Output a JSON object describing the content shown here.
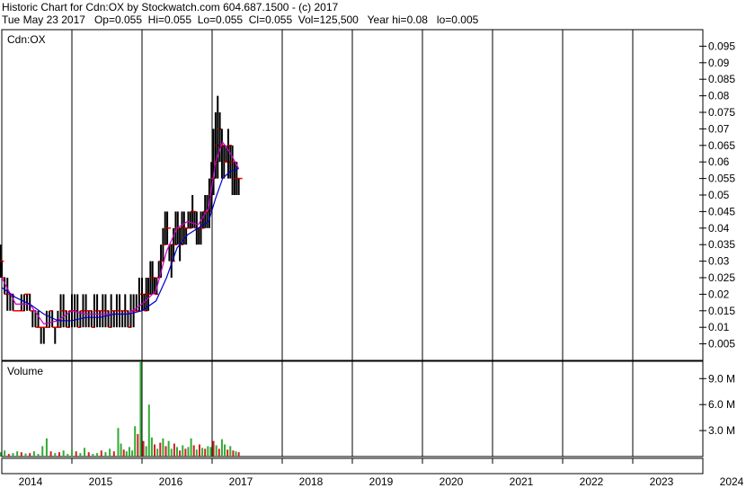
{
  "header": {
    "title_line": "Historic Chart for Cdn:OX by Stockwatch.com 604.687.1500 - (c) 2017",
    "quote_line": "Tue May 23 2017   Op=0.055  Hi=0.055  Lo=0.055  Cl=0.055  Vol=125,500   Year hi=0.08   lo=0.005"
  },
  "colors": {
    "price_bar": "#000000",
    "ma_short": "#cc00cc",
    "ma_long": "#0000cc",
    "close_tick": "#ff0000",
    "vol_up": "#33aa33",
    "vol_down": "#cc2222",
    "grid": "#000000"
  },
  "chart_data": [
    {
      "type": "line",
      "panel": "price",
      "title": "Cdn:OX",
      "y_ticks": [
        "0.095",
        "0.09",
        "0.085",
        "0.08",
        "0.075",
        "0.07",
        "0.065",
        "0.06",
        "0.055",
        "0.05",
        "0.045",
        "0.04",
        "0.035",
        "0.03",
        "0.025",
        "0.02",
        "0.015",
        "0.01",
        "0.005"
      ],
      "ylim": [
        0,
        0.1
      ],
      "x_ticks": [
        "2014",
        "2015",
        "2016",
        "2017",
        "2018",
        "2019",
        "2020",
        "2021",
        "2022",
        "2023",
        "2024"
      ],
      "grid": true,
      "series": [
        {
          "style": "hlc-bars",
          "x": [
            2013.98,
            2014.0,
            2014.04,
            2014.08,
            2014.12,
            2014.16,
            2014.2,
            2014.24,
            2014.28,
            2014.32,
            2014.36,
            2014.4,
            2014.44,
            2014.48,
            2014.52,
            2014.56,
            2014.6,
            2014.64,
            2014.68,
            2014.72,
            2014.76,
            2014.8,
            2014.84,
            2014.88,
            2014.92,
            2014.96,
            2015.0,
            2015.04,
            2015.08,
            2015.12,
            2015.16,
            2015.2,
            2015.24,
            2015.28,
            2015.32,
            2015.36,
            2015.4,
            2015.44,
            2015.48,
            2015.52,
            2015.56,
            2015.6,
            2015.64,
            2015.68,
            2015.72,
            2015.76,
            2015.8,
            2015.84,
            2015.88,
            2015.92,
            2015.96,
            2016.0,
            2016.03,
            2016.06,
            2016.09,
            2016.12,
            2016.15,
            2016.18,
            2016.21,
            2016.24,
            2016.27,
            2016.3,
            2016.33,
            2016.36,
            2016.39,
            2016.42,
            2016.45,
            2016.48,
            2016.51,
            2016.54,
            2016.57,
            2016.6,
            2016.63,
            2016.66,
            2016.69,
            2016.72,
            2016.75,
            2016.78,
            2016.81,
            2016.84,
            2016.87,
            2016.9,
            2016.93,
            2016.96,
            2016.99,
            2017.02,
            2017.05,
            2017.08,
            2017.11,
            2017.14,
            2017.17,
            2017.2,
            2017.23,
            2017.26,
            2017.29,
            2017.32,
            2017.35,
            2017.38
          ],
          "high": [
            0.035,
            0.03,
            0.025,
            0.025,
            0.02,
            0.02,
            0.015,
            0.015,
            0.02,
            0.02,
            0.02,
            0.02,
            0.015,
            0.015,
            0.015,
            0.01,
            0.01,
            0.015,
            0.015,
            0.015,
            0.01,
            0.015,
            0.02,
            0.02,
            0.015,
            0.015,
            0.02,
            0.02,
            0.02,
            0.015,
            0.02,
            0.02,
            0.015,
            0.015,
            0.02,
            0.02,
            0.015,
            0.02,
            0.02,
            0.015,
            0.02,
            0.015,
            0.02,
            0.02,
            0.015,
            0.02,
            0.015,
            0.02,
            0.02,
            0.02,
            0.025,
            0.025,
            0.02,
            0.025,
            0.025,
            0.03,
            0.03,
            0.025,
            0.025,
            0.03,
            0.035,
            0.04,
            0.045,
            0.045,
            0.035,
            0.035,
            0.04,
            0.045,
            0.045,
            0.04,
            0.045,
            0.045,
            0.04,
            0.045,
            0.045,
            0.05,
            0.045,
            0.045,
            0.04,
            0.045,
            0.045,
            0.05,
            0.05,
            0.055,
            0.06,
            0.07,
            0.075,
            0.08,
            0.075,
            0.07,
            0.065,
            0.065,
            0.07,
            0.065,
            0.065,
            0.06,
            0.06,
            0.055
          ],
          "low": [
            0.025,
            0.025,
            0.02,
            0.015,
            0.015,
            0.015,
            0.015,
            0.015,
            0.015,
            0.015,
            0.015,
            0.015,
            0.01,
            0.01,
            0.01,
            0.005,
            0.005,
            0.01,
            0.01,
            0.01,
            0.005,
            0.01,
            0.01,
            0.01,
            0.01,
            0.01,
            0.01,
            0.01,
            0.01,
            0.01,
            0.01,
            0.01,
            0.01,
            0.01,
            0.01,
            0.01,
            0.01,
            0.01,
            0.01,
            0.01,
            0.01,
            0.01,
            0.01,
            0.01,
            0.01,
            0.01,
            0.01,
            0.01,
            0.01,
            0.015,
            0.015,
            0.015,
            0.015,
            0.015,
            0.015,
            0.02,
            0.02,
            0.02,
            0.02,
            0.025,
            0.025,
            0.03,
            0.035,
            0.035,
            0.03,
            0.025,
            0.03,
            0.035,
            0.035,
            0.03,
            0.035,
            0.035,
            0.035,
            0.04,
            0.04,
            0.04,
            0.04,
            0.035,
            0.035,
            0.035,
            0.04,
            0.04,
            0.04,
            0.04,
            0.045,
            0.05,
            0.055,
            0.055,
            0.06,
            0.055,
            0.055,
            0.06,
            0.055,
            0.055,
            0.05,
            0.05,
            0.05,
            0.05
          ],
          "close": [
            0.03,
            0.025,
            0.02,
            0.02,
            0.02,
            0.015,
            0.015,
            0.015,
            0.015,
            0.02,
            0.02,
            0.015,
            0.015,
            0.01,
            0.01,
            0.01,
            0.01,
            0.01,
            0.015,
            0.01,
            0.01,
            0.01,
            0.015,
            0.015,
            0.01,
            0.015,
            0.015,
            0.015,
            0.01,
            0.015,
            0.015,
            0.015,
            0.015,
            0.01,
            0.015,
            0.015,
            0.015,
            0.015,
            0.015,
            0.01,
            0.015,
            0.015,
            0.015,
            0.015,
            0.015,
            0.015,
            0.01,
            0.015,
            0.015,
            0.015,
            0.02,
            0.02,
            0.015,
            0.02,
            0.02,
            0.025,
            0.025,
            0.02,
            0.025,
            0.03,
            0.03,
            0.035,
            0.04,
            0.04,
            0.035,
            0.03,
            0.035,
            0.04,
            0.04,
            0.035,
            0.04,
            0.04,
            0.04,
            0.04,
            0.045,
            0.045,
            0.04,
            0.04,
            0.04,
            0.04,
            0.045,
            0.045,
            0.045,
            0.05,
            0.055,
            0.06,
            0.065,
            0.07,
            0.065,
            0.065,
            0.06,
            0.06,
            0.065,
            0.06,
            0.06,
            0.055,
            0.055,
            0.055
          ]
        },
        {
          "style": "line",
          "color_key": "ma_short",
          "x": [
            2014.0,
            2014.2,
            2014.4,
            2014.6,
            2014.8,
            2015.0,
            2015.2,
            2015.4,
            2015.6,
            2015.8,
            2016.0,
            2016.2,
            2016.35,
            2016.5,
            2016.65,
            2016.8,
            2016.95,
            2017.05,
            2017.15,
            2017.25,
            2017.38
          ],
          "y": [
            0.025,
            0.017,
            0.017,
            0.011,
            0.012,
            0.015,
            0.014,
            0.014,
            0.014,
            0.014,
            0.017,
            0.021,
            0.033,
            0.04,
            0.042,
            0.041,
            0.046,
            0.06,
            0.066,
            0.063,
            0.058
          ]
        },
        {
          "style": "line",
          "color_key": "ma_long",
          "x": [
            2014.0,
            2014.2,
            2014.4,
            2014.6,
            2014.8,
            2015.0,
            2015.2,
            2015.4,
            2015.6,
            2015.8,
            2016.0,
            2016.2,
            2016.35,
            2016.5,
            2016.65,
            2016.8,
            2016.95,
            2017.05,
            2017.15,
            2017.25,
            2017.38
          ],
          "y": [
            0.022,
            0.019,
            0.017,
            0.014,
            0.012,
            0.012,
            0.013,
            0.013,
            0.014,
            0.014,
            0.015,
            0.018,
            0.025,
            0.034,
            0.038,
            0.04,
            0.042,
            0.049,
            0.055,
            0.057,
            0.058
          ]
        }
      ]
    },
    {
      "type": "bar",
      "panel": "volume",
      "title": "Volume",
      "y_ticks": [
        "9.0 M",
        "6.0 M",
        "3.0 M"
      ],
      "ylim": [
        0,
        11000000
      ],
      "x": [
        2013.98,
        2014.04,
        2014.1,
        2014.16,
        2014.22,
        2014.28,
        2014.34,
        2014.4,
        2014.46,
        2014.52,
        2014.58,
        2014.64,
        2014.7,
        2014.76,
        2014.82,
        2014.88,
        2014.94,
        2015.0,
        2015.06,
        2015.12,
        2015.18,
        2015.24,
        2015.3,
        2015.36,
        2015.42,
        2015.48,
        2015.54,
        2015.6,
        2015.66,
        2015.7,
        2015.74,
        2015.78,
        2015.82,
        2015.86,
        2015.9,
        2015.94,
        2015.98,
        2016.02,
        2016.06,
        2016.1,
        2016.14,
        2016.18,
        2016.22,
        2016.26,
        2016.3,
        2016.34,
        2016.38,
        2016.42,
        2016.46,
        2016.5,
        2016.54,
        2016.58,
        2016.62,
        2016.66,
        2016.7,
        2016.74,
        2016.78,
        2016.82,
        2016.86,
        2016.9,
        2016.94,
        2016.98,
        2017.02,
        2017.06,
        2017.1,
        2017.14,
        2017.18,
        2017.22,
        2017.26,
        2017.3,
        2017.34,
        2017.38
      ],
      "values": [
        500000,
        700000,
        300000,
        400000,
        600000,
        500000,
        350000,
        400000,
        600000,
        300000,
        1200000,
        2100000,
        600000,
        400000,
        500000,
        700000,
        300000,
        800000,
        600000,
        400000,
        1000000,
        500000,
        300000,
        400000,
        700000,
        500000,
        900000,
        600000,
        3300000,
        1500000,
        800000,
        600000,
        1100000,
        700000,
        3500000,
        2600000,
        11000000,
        1800000,
        1200000,
        6000000,
        2200000,
        1400000,
        900000,
        1600000,
        2100000,
        1200000,
        1800000,
        900000,
        1500000,
        1100000,
        700000,
        1300000,
        900000,
        1100000,
        2100000,
        1300000,
        800000,
        1400000,
        1000000,
        900000,
        1200000,
        1100000,
        1800000,
        1300000,
        900000,
        2000000,
        1400000,
        800000,
        1200000,
        700000,
        600000,
        500000
      ],
      "up": [
        true,
        true,
        false,
        true,
        true,
        false,
        true,
        false,
        true,
        true,
        true,
        true,
        false,
        true,
        false,
        true,
        true,
        true,
        false,
        true,
        true,
        false,
        true,
        true,
        false,
        true,
        true,
        false,
        true,
        true,
        false,
        true,
        true,
        true,
        true,
        false,
        true,
        false,
        true,
        true,
        true,
        false,
        true,
        false,
        true,
        false,
        true,
        true,
        false,
        true,
        false,
        true,
        false,
        true,
        true,
        false,
        true,
        false,
        true,
        false,
        true,
        true,
        false,
        true,
        false,
        true,
        true,
        false,
        true,
        false,
        true,
        false
      ]
    }
  ]
}
